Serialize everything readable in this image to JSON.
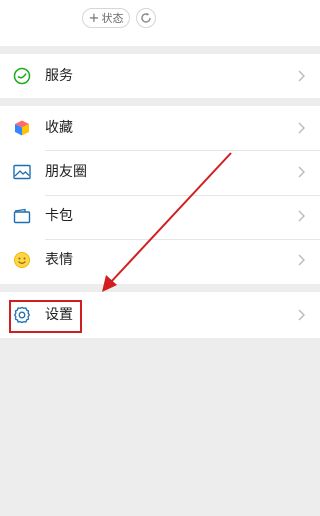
{
  "profile": {
    "status_label": "状态",
    "plus_glyph": "+"
  },
  "menu": {
    "services": {
      "label": "服务",
      "icon": "services-icon"
    },
    "favorites": {
      "label": "收藏",
      "icon": "favorites-icon"
    },
    "moments": {
      "label": "朋友圈",
      "icon": "moments-icon"
    },
    "cards": {
      "label": "卡包",
      "icon": "card-package-icon"
    },
    "stickers": {
      "label": "表情",
      "icon": "stickers-icon"
    },
    "settings": {
      "label": "设置",
      "icon": "settings-icon"
    }
  },
  "annotation": {
    "color": "#d11f1f",
    "target": "settings"
  },
  "colors": {
    "page_bg": "#ededed",
    "row_bg": "#ffffff",
    "text": "#1f1f1f",
    "icon_blue": "#1f6fb2",
    "icon_green": "#1aad19"
  }
}
